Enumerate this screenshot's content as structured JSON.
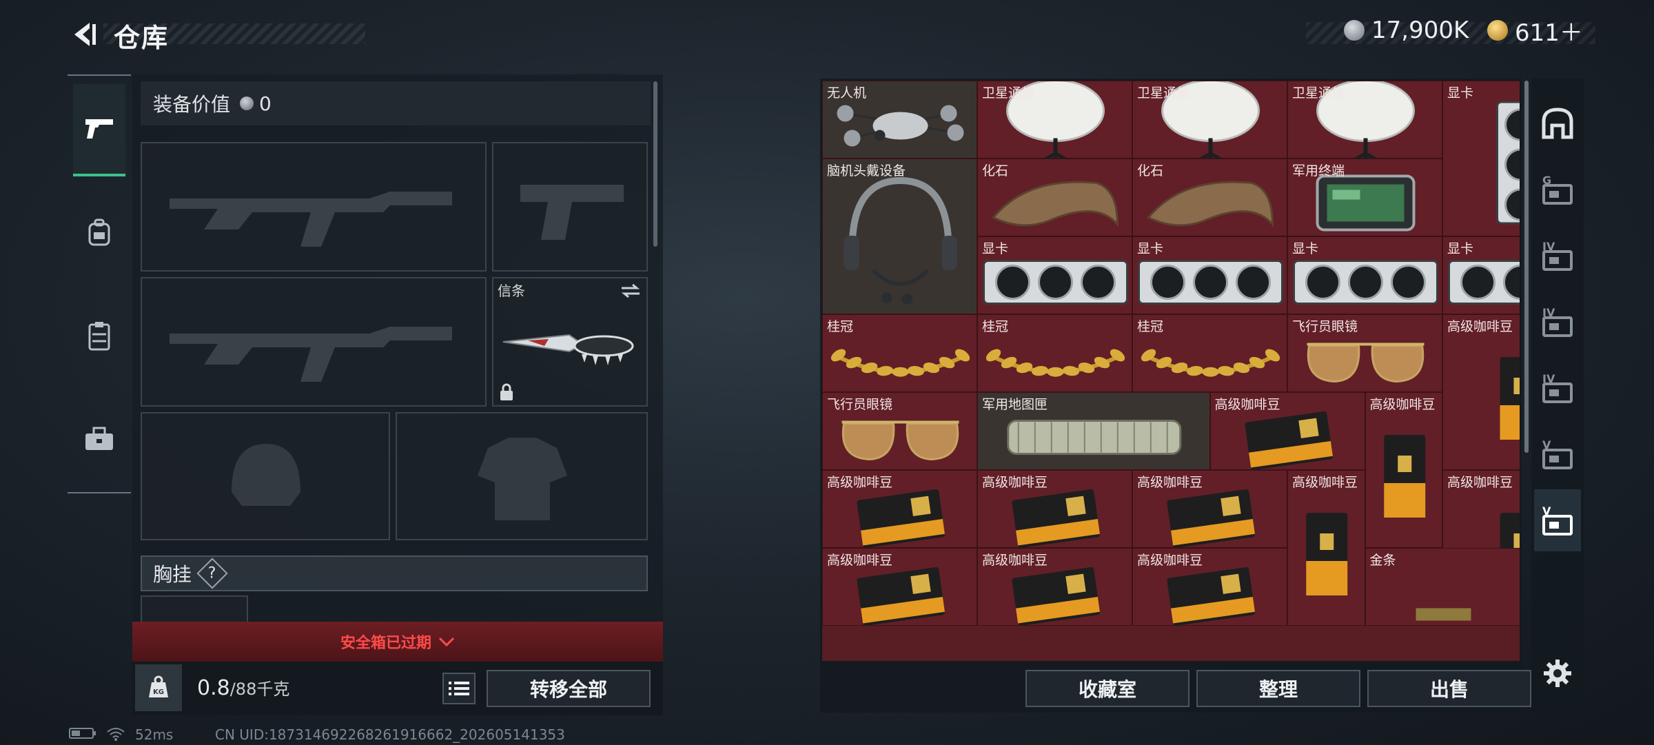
{
  "header": {
    "title": "仓库"
  },
  "currency": [
    {
      "icon": "silver-coin-icon",
      "value": "17,900K"
    },
    {
      "icon": "gold-coin-icon",
      "value": "611＋"
    }
  ],
  "left_nav": [
    {
      "name": "weapon-tab",
      "icon": "pistol-icon",
      "active": true
    },
    {
      "name": "backpack-tab",
      "icon": "backpack-icon",
      "active": false
    },
    {
      "name": "chest-rig-tab",
      "icon": "vest-icon",
      "active": false
    },
    {
      "name": "toolbox-tab",
      "icon": "toolbox-icon",
      "active": false
    }
  ],
  "loadout": {
    "value_label": "装备价值",
    "value": "0",
    "melee_label": "信条",
    "chest_label": "胸挂",
    "chest_help": "?"
  },
  "safebox": {
    "expired_label": "安全箱已过期"
  },
  "capacity": {
    "current": "0.8",
    "max": "/88千克"
  },
  "buttons": {
    "transfer_all": "转移全部",
    "collection": "收藏室",
    "sort": "整理",
    "sell": "出售"
  },
  "stash_items": [
    {
      "label": "无人机",
      "item": "drone"
    },
    {
      "label": "卫星通信",
      "item": "satellite-dish"
    },
    {
      "label": "卫星通信",
      "item": "satellite-dish"
    },
    {
      "label": "卫星通信",
      "item": "satellite-dish"
    },
    {
      "label": "显卡",
      "item": "gpu"
    },
    {
      "label": "脑机头戴设备",
      "item": "headset"
    },
    {
      "label": "化石",
      "item": "fossil"
    },
    {
      "label": "化石",
      "item": "fossil"
    },
    {
      "label": "军用终端",
      "item": "terminal"
    },
    {
      "label": "显卡",
      "item": "gpu"
    },
    {
      "label": "显卡",
      "item": "gpu"
    },
    {
      "label": "显卡",
      "item": "gpu"
    },
    {
      "label": "显卡",
      "item": "gpu"
    },
    {
      "label": "桂冠",
      "item": "laurel"
    },
    {
      "label": "桂冠",
      "item": "laurel"
    },
    {
      "label": "桂冠",
      "item": "laurel"
    },
    {
      "label": "飞行员眼镜",
      "item": "sunglasses"
    },
    {
      "label": "高级咖啡豆",
      "item": "coffee-bag"
    },
    {
      "label": "飞行员眼镜",
      "item": "sunglasses"
    },
    {
      "label": "军用地图匣",
      "item": "map-tube"
    },
    {
      "label": "高级咖啡豆",
      "item": "coffee-pack"
    },
    {
      "label": "高级咖啡豆",
      "item": "coffee-bag"
    },
    {
      "label": "高级咖啡豆",
      "item": "coffee-pack"
    },
    {
      "label": "高级咖啡豆",
      "item": "coffee-pack"
    },
    {
      "label": "高级咖啡豆",
      "item": "coffee-pack"
    },
    {
      "label": "高级咖啡豆",
      "item": "coffee-bag"
    },
    {
      "label": "高级咖啡豆",
      "item": "coffee-bag"
    },
    {
      "label": "高级咖啡豆",
      "item": "coffee-pack"
    },
    {
      "label": "高级咖啡豆",
      "item": "coffee-pack"
    },
    {
      "label": "高级咖啡豆",
      "item": "coffee-pack"
    },
    {
      "label": "金条",
      "item": "gold-bar"
    }
  ],
  "right_sidebar": [
    {
      "name": "home-container",
      "label": ""
    },
    {
      "name": "container-g",
      "label": "G"
    },
    {
      "name": "container-iv-a",
      "label": "IV"
    },
    {
      "name": "container-iv-add",
      "label": "IV"
    },
    {
      "name": "container-iv-b",
      "label": "IV"
    },
    {
      "name": "container-v-a",
      "label": "V"
    },
    {
      "name": "container-v-b",
      "label": "V"
    }
  ],
  "status": {
    "ping": "52ms",
    "uid": "CN UID:18731469226826191666​2_202605141353"
  },
  "colors": {
    "accent": "#3ec08b",
    "warning": "#ff4a4a",
    "cell_red": "#621f27"
  }
}
